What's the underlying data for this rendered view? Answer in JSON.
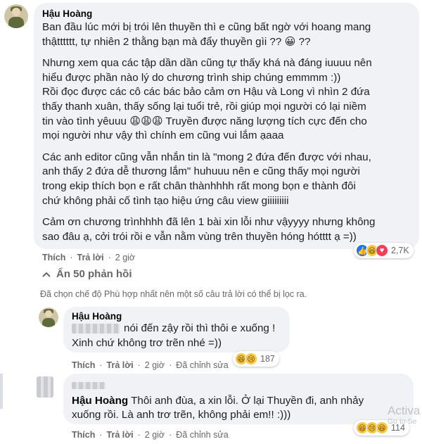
{
  "comment": {
    "author": "Hậu Hoàng",
    "paragraphs": [
      [
        "Ban đầu lúc mới bị trói lên thuyền thì e cũng bất ngờ với hoang mang",
        "thậtttttt, tự nhiên 2 thằng bạn mà đẩy thuyền gìi ?? 😀 ??"
      ],
      [
        "Nhưng xem qua các tập dần dần cũng tự thấy khá nà đáng iuuuu nên",
        "hiểu được phần nào lý do chương trình ship chúng emmmm :))",
        "Rồi đọc được các cô các bác bảo cảm ơn Hậu và Long vì nhìn 2 đứa",
        "thấy thanh xuân, thấy sống lại tuổi trẻ, rồi giúp mọi người có lại niềm",
        "tin vào tình yêuuu 😩😩😩 Truyền được năng lượng tích cực đến cho",
        "mọi người như vậy thì chính em cũng vui lắm ạaaa"
      ],
      [
        "Các anh editor cũng vẫn nhắn tin là \"mong 2 đứa đến được với nhau,",
        "anh thấy 2 đứa dễ thương lắm\" huhuuu nên e cũng thấy mọi người",
        "trong ekip thích bọn e rất chân thànhhhh rất mong bọn e thành đôi",
        "chứ không phải cố tình tạo hiệu ứng câu view giiiiiiiii"
      ],
      [
        "Cảm ơn chương trìnhhhh đã lên 1 bài xin lỗi như vậyyyy nhưng không",
        "sao đâu ạ, cởi trói rồi e vẫn nằm vùng trên thuyền hóng hótttt ạ =))"
      ]
    ],
    "actions": {
      "like": "Thích",
      "reply": "Trả lời",
      "time": "2 giờ"
    },
    "reactions": {
      "icons": [
        "like-icon",
        "haha-icon",
        "love-icon"
      ],
      "count": "2,7K"
    }
  },
  "hide_replies": {
    "label": "Ẩn 50 phản hồi",
    "icon": "chevron-up-icon"
  },
  "filter_notice": "Đã chọn chế độ Phù hợp nhất nên một số câu trả lời có thể bị lọc ra.",
  "replies": [
    {
      "author": "Hậu Hoàng",
      "lines": [
        "nói đến zậy rồi thì thôi e xuống !",
        "Xinh chứ không trơ trẽn nhé =))"
      ],
      "actions": {
        "like": "Thích",
        "reply": "Trả lời",
        "time": "2 giờ",
        "edited": "Đã chỉnh sửa"
      },
      "reactions": {
        "icons": [
          "haha-icon",
          "sad-icon"
        ],
        "count": "187"
      }
    },
    {
      "author_tag": "Hậu Hoàng",
      "lines": [
        "Thôi anh đùa, a xin lỗi. Ở lại Thuyền đi, anh nhảy",
        "xuống rồi. Là anh trơ trẽn, không phải em!! :)))"
      ],
      "actions": {
        "like": "Thích",
        "reply": "Trả lời",
        "time": "2 giờ",
        "edited": "Đã chỉnh sửa"
      },
      "reactions": {
        "icons": [
          "haha-icon",
          "sad-icon",
          "haha-icon"
        ],
        "count": "114"
      }
    }
  ],
  "watermark": {
    "main": "Activa",
    "sub": "Go to Se"
  }
}
